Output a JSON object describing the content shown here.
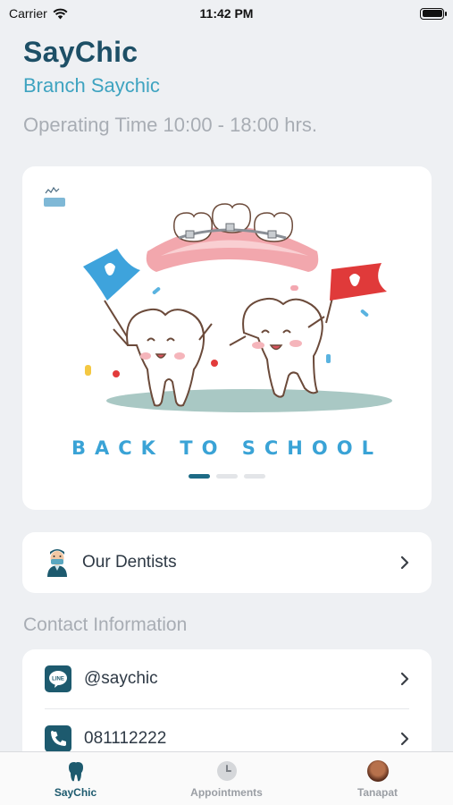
{
  "status_bar": {
    "carrier": "Carrier",
    "time": "11:42 PM"
  },
  "header": {
    "title": "SayChic",
    "branch": "Branch Saychic",
    "hours": "Operating Time 10:00 - 18:00 hrs."
  },
  "banner": {
    "caption": "BACK TO SCHOOL",
    "page_count": 3,
    "active_page": 1
  },
  "dentists": {
    "label": "Our Dentists"
  },
  "contact": {
    "title": "Contact Information",
    "items": [
      {
        "icon": "line-icon",
        "label": "@saychic"
      },
      {
        "icon": "phone-icon",
        "label": "081112222"
      }
    ]
  },
  "tabs": [
    {
      "icon": "tooth-icon",
      "label": "SayChic",
      "active": true
    },
    {
      "icon": "clock-icon",
      "label": "Appointments",
      "active": false
    },
    {
      "icon": "avatar",
      "label": "Tanapat",
      "active": false
    }
  ],
  "colors": {
    "primary": "#1d5a6e",
    "accent": "#3ea3c0",
    "muted": "#a8adb4",
    "background": "#eef0f3"
  }
}
